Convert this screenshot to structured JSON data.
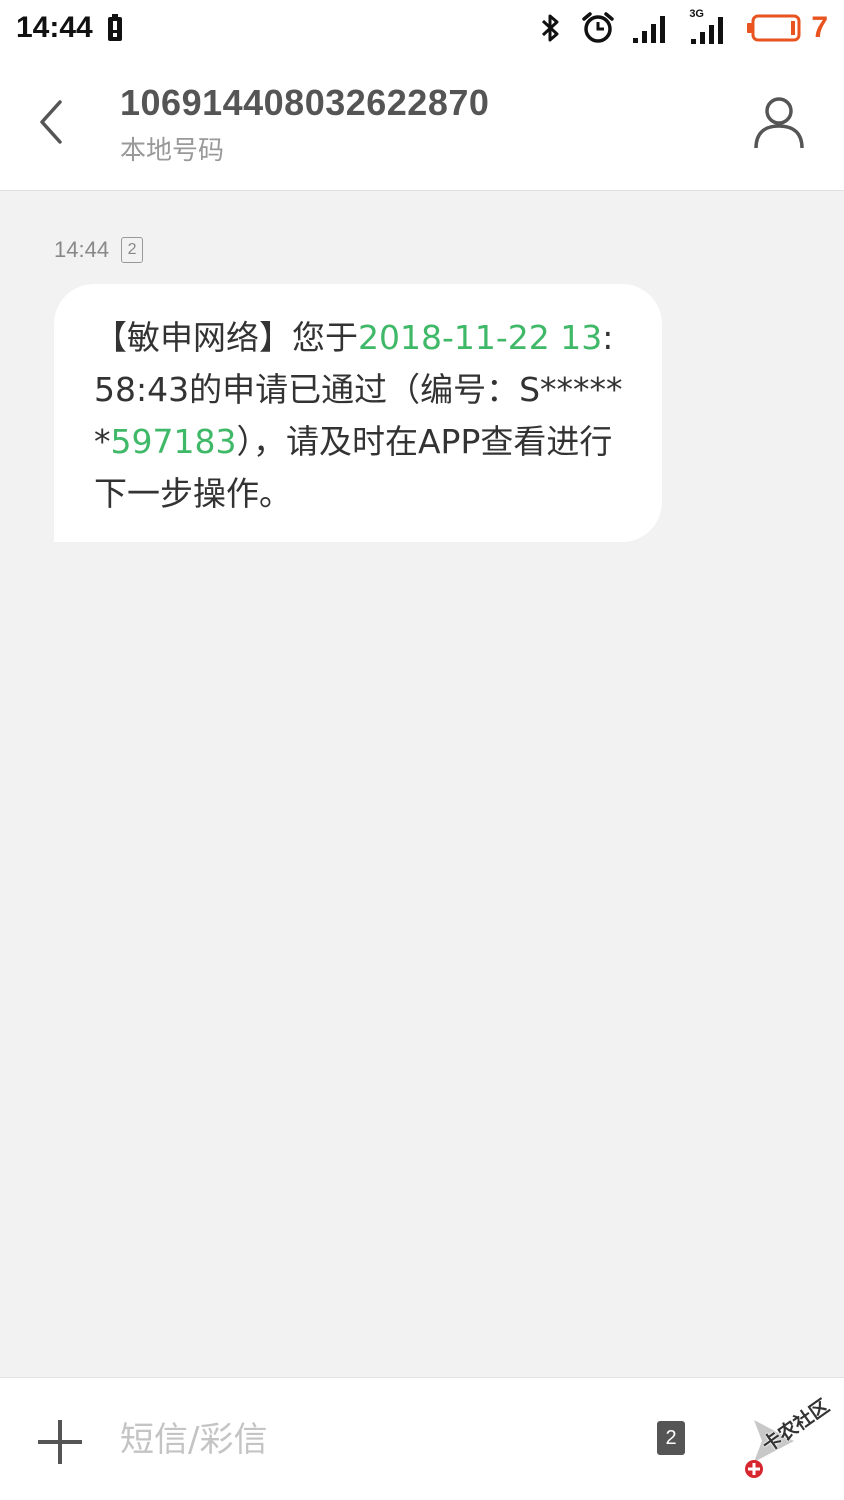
{
  "status_bar": {
    "time": "14:44",
    "battery_level": "7",
    "network_label": "3G",
    "colors": {
      "battery": "#e8531f"
    }
  },
  "header": {
    "contact_number": "106914408032622870",
    "contact_sub": "本地号码"
  },
  "messages": [
    {
      "time": "14:44",
      "sim": "2",
      "text_parts": [
        "【敏申网络】您于",
        "2018-11-22 13",
        ":58:43的申请已通过（编号：S******",
        "597183",
        "），请及时在APP查看进行下一步操作。"
      ]
    }
  ],
  "composer": {
    "placeholder": "短信/彩信",
    "sim": "2"
  },
  "watermark": {
    "text": "卡农社区"
  },
  "icons": {
    "back": "chevron-left-icon",
    "contact": "person-icon",
    "add": "plus-icon",
    "send": "send-icon",
    "bluetooth": "bluetooth-icon",
    "alarm": "alarm-icon",
    "signal": "signal-icon"
  },
  "colors": {
    "link": "#3fb868",
    "background": "#f2f2f2"
  }
}
